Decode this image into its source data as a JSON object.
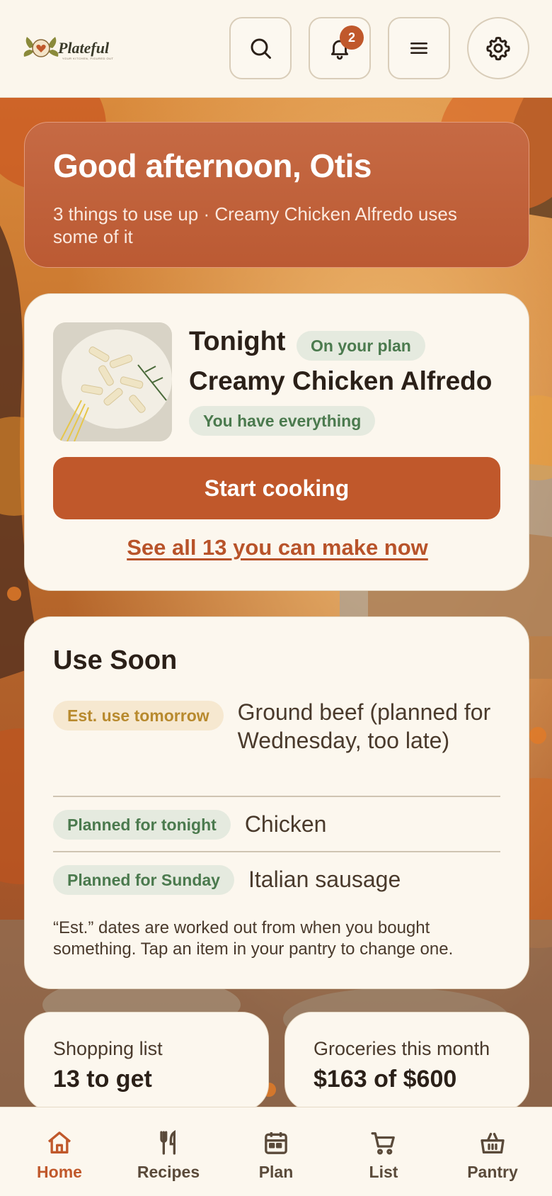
{
  "header": {
    "logo_text": "Plateful",
    "logo_tagline": "YOUR KITCHEN, FIGURED OUT",
    "notification_count": "2",
    "buttons": [
      "search-icon",
      "bell-icon",
      "menu-icon",
      "gear-icon"
    ]
  },
  "greeting": {
    "title": "Good afternoon, Otis",
    "subtitle": "3 things to use up · Creamy Chicken Alfredo uses some of it"
  },
  "tonight": {
    "label": "Tonight",
    "plan_badge": "On your plan",
    "dish": "Creamy Chicken Alfredo",
    "status": "You have everything",
    "cta": "Start cooking",
    "see_all": "See all 13 you can make now"
  },
  "use_soon": {
    "title": "Use Soon",
    "items": [
      {
        "badge": "Est. use tomorrow",
        "badge_tone": "amber",
        "name": "Ground beef (planned for Wednesday, too late)"
      },
      {
        "badge": "Planned for tonight",
        "badge_tone": "green",
        "name": "Chicken"
      },
      {
        "badge": "Planned for Sunday",
        "badge_tone": "green",
        "name": "Italian sausage"
      }
    ],
    "note": "“Est.” dates are worked out from when you bought something. Tap an item in your pantry to change one."
  },
  "shopping": {
    "label": "Shopping list",
    "value": "13 to get"
  },
  "groceries": {
    "label": "Groceries this month",
    "value": "$163 of $600"
  },
  "nav": {
    "items": [
      {
        "label": "Home",
        "icon": "home-icon",
        "active": true
      },
      {
        "label": "Recipes",
        "icon": "utensils-icon",
        "active": false
      },
      {
        "label": "Plan",
        "icon": "calendar-icon",
        "active": false
      },
      {
        "label": "List",
        "icon": "cart-icon",
        "active": false
      },
      {
        "label": "Pantry",
        "icon": "basket-icon",
        "active": false
      }
    ]
  },
  "colors": {
    "accent": "#c0582b",
    "background": "#fbf6ec",
    "card": "#fcf7ee",
    "green_text": "#4b7a4e",
    "amber_text": "#b88a2e"
  }
}
